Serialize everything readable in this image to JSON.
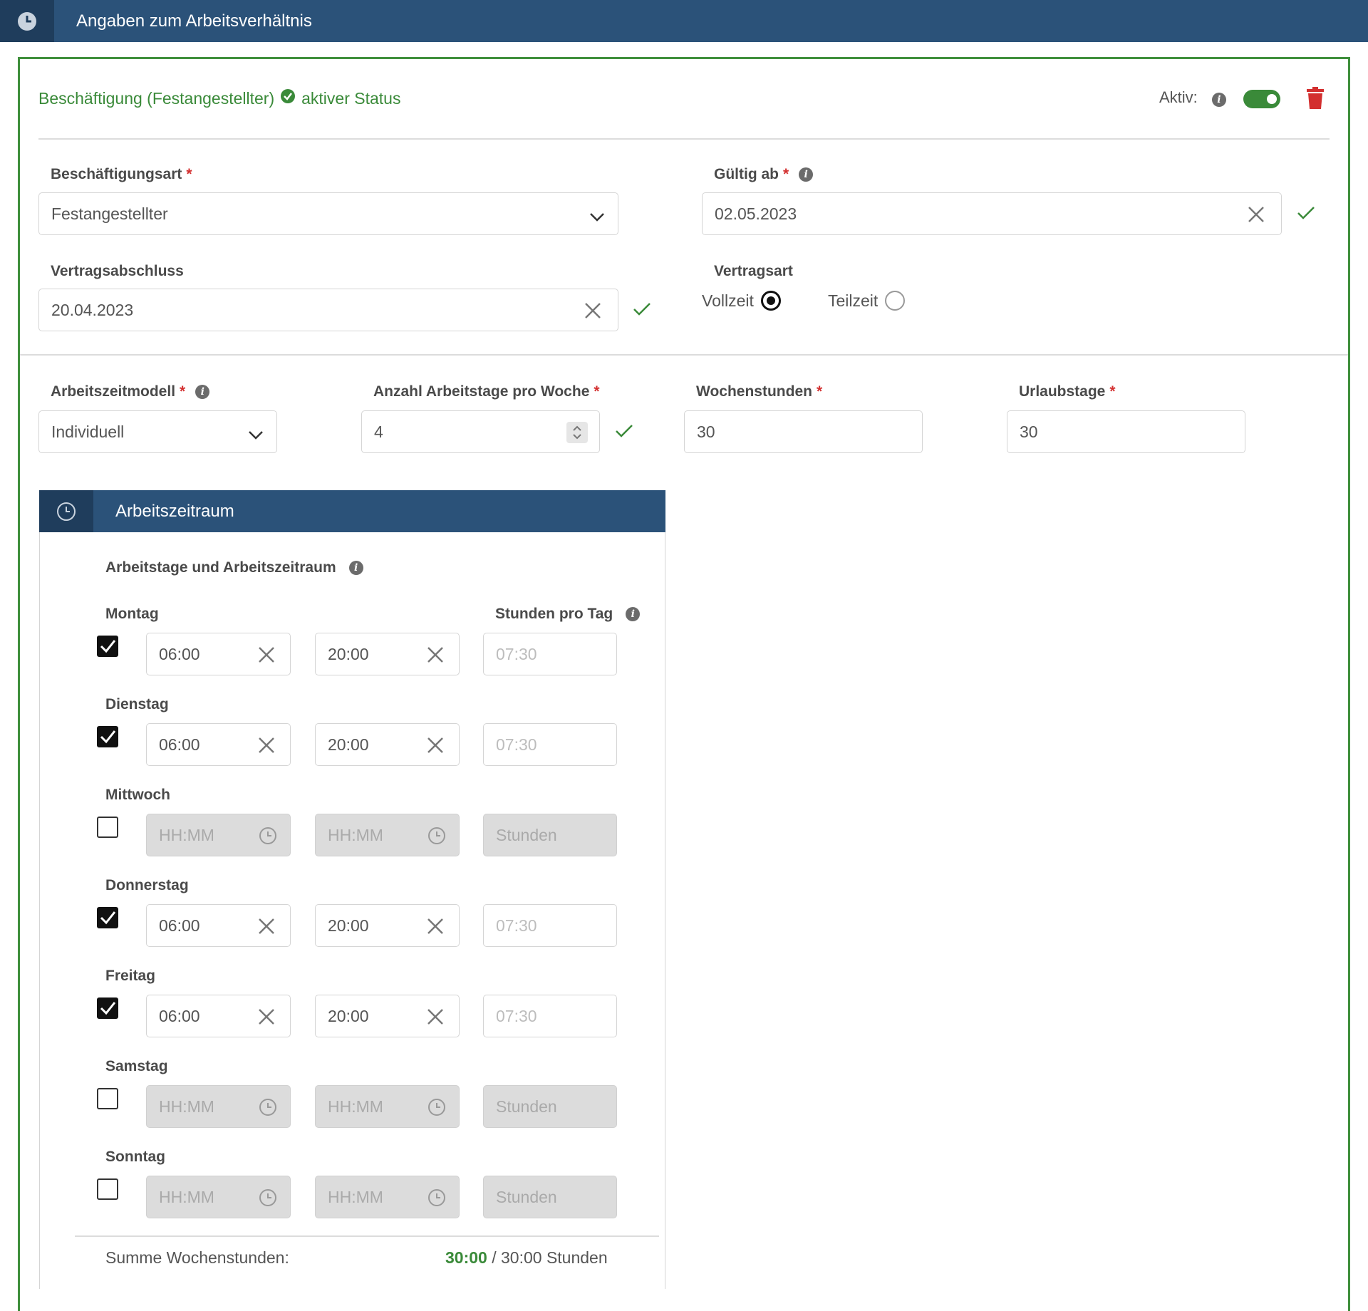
{
  "header": {
    "title": "Angaben zum Arbeitsverhältnis"
  },
  "status": {
    "employment": "Beschäftigung (Festangestellter)",
    "state": "aktiver Status",
    "aktiv_label": "Aktiv:",
    "aktiv_on": true
  },
  "form": {
    "beschaeftigungsart": {
      "label": "Beschäftigungsart",
      "value": "Festangestellter"
    },
    "gueltig_ab": {
      "label": "Gültig ab",
      "value": "02.05.2023"
    },
    "vertragsabschluss": {
      "label": "Vertragsabschluss",
      "value": "20.04.2023"
    },
    "vertragsart": {
      "label": "Vertragsart",
      "options": [
        "Vollzeit",
        "Teilzeit"
      ],
      "selected": "Vollzeit"
    },
    "arbeitszeitmodell": {
      "label": "Arbeitszeitmodell",
      "value": "Individuell"
    },
    "arbeitstage": {
      "label": "Anzahl Arbeitstage pro Woche",
      "value": "4"
    },
    "wochenstunden": {
      "label": "Wochenstunden",
      "value": "30"
    },
    "urlaubstage": {
      "label": "Urlaubstage",
      "value": "30"
    }
  },
  "arbeitszeitraum": {
    "title": "Arbeitszeitraum",
    "section_label": "Arbeitstage und Arbeitszeitraum",
    "hours_label": "Stunden pro Tag",
    "days": [
      {
        "name": "Montag",
        "checked": true,
        "start": "06:00",
        "end": "20:00",
        "hours": "07:30"
      },
      {
        "name": "Dienstag",
        "checked": true,
        "start": "06:00",
        "end": "20:00",
        "hours": "07:30"
      },
      {
        "name": "Mittwoch",
        "checked": false,
        "start": "HH:MM",
        "end": "HH:MM",
        "hours": "Stunden"
      },
      {
        "name": "Donnerstag",
        "checked": true,
        "start": "06:00",
        "end": "20:00",
        "hours": "07:30"
      },
      {
        "name": "Freitag",
        "checked": true,
        "start": "06:00",
        "end": "20:00",
        "hours": "07:30"
      },
      {
        "name": "Samstag",
        "checked": false,
        "start": "HH:MM",
        "end": "HH:MM",
        "hours": "Stunden"
      },
      {
        "name": "Sonntag",
        "checked": false,
        "start": "HH:MM",
        "end": "HH:MM",
        "hours": "Stunden"
      }
    ],
    "sum_label": "Summe Wochenstunden:",
    "sum_current": "30:00",
    "sum_target": "/ 30:00 Stunden"
  },
  "colors": {
    "header": "#2b5279",
    "accent_green": "#3a8a39",
    "required": "#d32f2f",
    "delete": "#d32f2f"
  }
}
